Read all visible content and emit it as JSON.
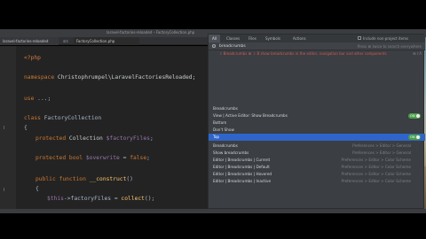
{
  "window": {
    "title": "laravel-factories-reloaded – FactoryCollection.php"
  },
  "editor_tabs": {
    "project": "laravel-factories-reloaded",
    "small": "src",
    "file": "FactoryCollection.php"
  },
  "code": {
    "php_open": "<?php",
    "namespace_kw": "namespace",
    "namespace_val": "Christophrumpel\\LaravelFactoriesReloaded;",
    "use_kw": "use",
    "use_val": "...;",
    "class_kw": "class",
    "class_name": "FactoryCollection",
    "brace_open": "{",
    "prop1_kw": "protected",
    "prop1_type": "Collection",
    "prop1_var": "$factoryFiles",
    "prop1_end": ";",
    "prop2_kw": "protected",
    "prop2_type": "bool",
    "prop2_var": "$overwrite",
    "prop2_eq": " = ",
    "prop2_val": "false",
    "prop2_end": ";",
    "ctor_kw1": "public",
    "ctor_kw2": "function",
    "ctor_name": "__construct",
    "ctor_args": "()",
    "brace_open2": "{",
    "assign_var": "$this",
    "assign_rest": "->factoryFiles = ",
    "assign_fn": "collect",
    "assign_end": "();"
  },
  "search_popup": {
    "tabs": [
      "All",
      "Classes",
      "Files",
      "Symbols",
      "Actions"
    ],
    "include_label": "Include non-project items",
    "query": "breadcrumbs",
    "query_hint": "Press ⌘ twice to search everywhere",
    "shortcut_text": "⇧ Breadcrumbs     ⌘ ⇧ B show breadcrumbs in the editor, navigation bar and other components",
    "shortcut_hint": "⌘⇧A",
    "results": [
      {
        "label": "Breadcrumbs",
        "hint": "",
        "toggle": ""
      },
      {
        "label": "View | Active Editor: Show Breadcrumbs",
        "hint": "",
        "toggle": "ON"
      },
      {
        "label": "Bottom",
        "hint": "",
        "toggle": ""
      },
      {
        "label": "Don't Show",
        "hint": "",
        "toggle": ""
      },
      {
        "label": "Top",
        "hint": "",
        "toggle": "ON"
      },
      {
        "label": "Breadcrumbs",
        "hint": "Preferences > Editor > General",
        "toggle": ""
      },
      {
        "label": "Show breadcrumbs",
        "hint": "Preferences > Editor > General",
        "toggle": ""
      },
      {
        "label": "Editor | Breadcrumbs | Current",
        "hint": "Preferences > Editor > Color Scheme",
        "toggle": ""
      },
      {
        "label": "Editor | Breadcrumbs | Default",
        "hint": "Preferences > Editor > Color Scheme",
        "toggle": ""
      },
      {
        "label": "Editor | Breadcrumbs | Hovered",
        "hint": "Preferences > Editor > Color Scheme",
        "toggle": ""
      },
      {
        "label": "Editor | Breadcrumbs | Inactive",
        "hint": "Preferences > Editor > Color Scheme",
        "toggle": ""
      }
    ]
  },
  "colors": {
    "selection": "#2f65ca",
    "toggle_on": "#4b9f4b",
    "keyword": "#cc7832",
    "variable": "#9876aa",
    "function": "#ffc66d"
  }
}
